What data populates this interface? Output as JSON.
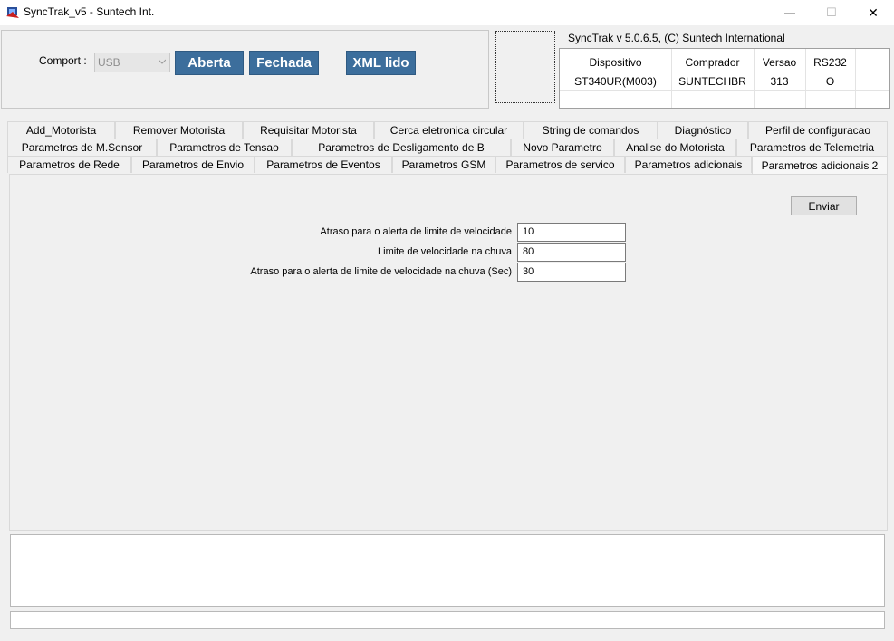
{
  "window": {
    "title": "SyncTrak_v5 - Suntech Int.",
    "minimize": "—",
    "maximize": "☐",
    "close": "✕"
  },
  "connection": {
    "comport_label": "Comport :",
    "comport_value": "USB",
    "open_label": "Aberta",
    "close_label": "Fechada",
    "xml_label": "XML lido"
  },
  "info": {
    "title": "SyncTrak v 5.0.6.5, (C) Suntech International",
    "headers": [
      "Dispositivo",
      "Comprador",
      "Versao",
      "RS232"
    ],
    "values": [
      "ST340UR(M003)",
      "SUNTECHBR",
      "313",
      "O"
    ]
  },
  "tabs": {
    "row1": [
      "Add_Motorista",
      "Remover Motorista",
      "Requisitar Motorista",
      "Cerca eletronica circular",
      "String de comandos",
      "Diagnóstico",
      "Perfil de configuracao"
    ],
    "row2": [
      "Parametros  de M.Sensor",
      "Parametros de Tensao",
      "Parametros de Desligamento de B",
      "Novo Parametro",
      "Analise do Motorista",
      "Parametros de Telemetria"
    ],
    "row3": [
      "Parametros de Rede",
      "Parametros de Envio",
      "Parametros de Eventos",
      "Parametros GSM",
      "Parametros de servico",
      "Parametros adicionais",
      "Parametros adicionais 2"
    ],
    "active": "Parametros adicionais 2"
  },
  "form": {
    "send_label": "Enviar",
    "fields": [
      {
        "label": "Atraso para o alerta de limite de velocidade",
        "value": "10"
      },
      {
        "label": "Limite de velocidade na chuva",
        "value": "80"
      },
      {
        "label": "Atraso para o alerta de limite de velocidade na chuva (Sec)",
        "value": "30"
      }
    ]
  },
  "colors": {
    "accent_button": "#3c6e9c"
  }
}
